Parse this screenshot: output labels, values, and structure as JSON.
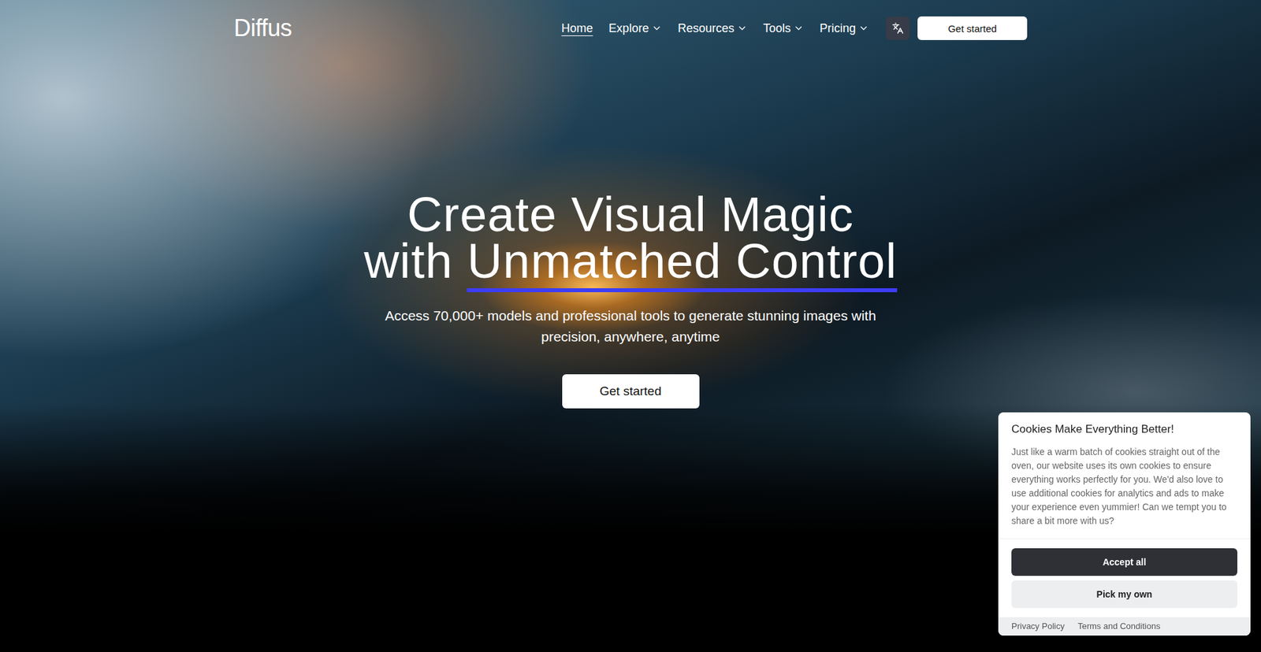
{
  "nav": {
    "logo": "Diffus",
    "links": [
      {
        "label": "Home",
        "selected": true,
        "dropdown": false
      },
      {
        "label": "Explore",
        "selected": false,
        "dropdown": true
      },
      {
        "label": "Resources",
        "selected": false,
        "dropdown": true
      },
      {
        "label": "Tools",
        "selected": false,
        "dropdown": true
      },
      {
        "label": "Pricing",
        "selected": false,
        "dropdown": true
      }
    ],
    "cta": "Get started"
  },
  "hero": {
    "title_line1": "Create Visual Magic",
    "title_line2_plain": "with ",
    "title_line2_highlight": "Unmatched Control",
    "subtitle": "Access 70,000+ models and professional tools to generate stunning images with precision, anywhere, anytime",
    "cta": "Get started"
  },
  "cookie_banner": {
    "title": "Cookies Make Everything Better!",
    "body": "Just like a warm batch of cookies straight out of the oven, our website uses its own cookies to ensure everything works perfectly for you. We'd also love to use additional cookies for analytics and ads to make your experience even yummier! Can we tempt you to share a bit more with us?",
    "buttons": [
      {
        "label": "Accept all",
        "kind": "primary"
      },
      {
        "label": "Pick my own",
        "kind": "secondary"
      }
    ],
    "links": [
      "Privacy Policy",
      "Terms and Conditions"
    ]
  }
}
